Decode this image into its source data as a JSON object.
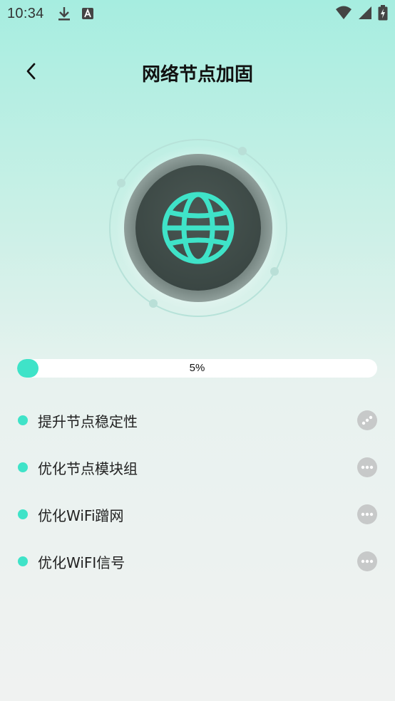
{
  "status_bar": {
    "time": "10:34",
    "icons_left": [
      "download-icon",
      "font-a-icon"
    ],
    "icons_right": [
      "wifi-icon",
      "signal-icon",
      "battery-charging-icon"
    ]
  },
  "header": {
    "title": "网络节点加固",
    "back_icon": "chevron-left-icon"
  },
  "hero": {
    "icon": "globe-icon",
    "accent_color": "#3fe3c8"
  },
  "progress": {
    "value_percent": 5,
    "label": "5%",
    "fill_color": "#3fe3c8"
  },
  "tasks": [
    {
      "label": "提升节点稳定性",
      "status": "loading",
      "status_icon": "loading-dots-icon"
    },
    {
      "label": "优化节点模块组",
      "status": "pending",
      "status_icon": "more-dots-icon"
    },
    {
      "label": "优化WiFi蹭网",
      "status": "pending",
      "status_icon": "more-dots-icon"
    },
    {
      "label": "优化WiFI信号",
      "status": "pending",
      "status_icon": "more-dots-icon"
    }
  ]
}
